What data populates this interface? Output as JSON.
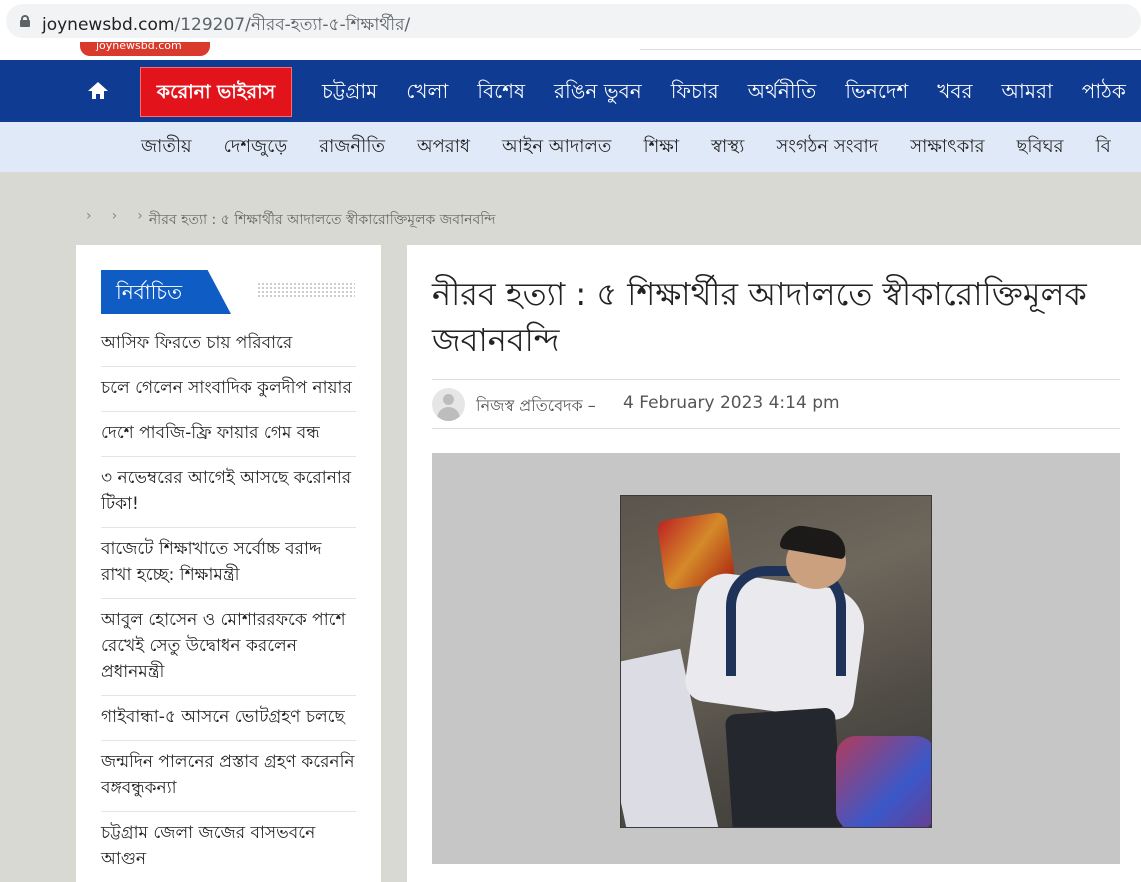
{
  "browser": {
    "url_host": "joynewsbd.com",
    "url_path": "/129207/নীরব-হত্যা-৫-শিক্ষার্থীর/"
  },
  "site": {
    "logo_text": "joynewsbd.com"
  },
  "main_nav": {
    "highlight": "করোনা ভাইরাস",
    "items": [
      "চট্টগ্রাম",
      "খেলা",
      "বিশেষ",
      "রঙিন ভুবন",
      "ফিচার",
      "অর্থনীতি",
      "ভিনদেশ",
      "খবর",
      "আমরা",
      "পাঠক"
    ]
  },
  "sub_nav": {
    "items": [
      "জাতীয়",
      "দেশজুড়ে",
      "রাজনীতি",
      "অপরাধ",
      "আইন আদালত",
      "শিক্ষা",
      "স্বাস্থ্য",
      "সংগঠন সংবাদ",
      "সাক্ষাৎকার",
      "ছবিঘর",
      "বি"
    ]
  },
  "breadcrumb": {
    "chevron": "›",
    "current": "নীরব হত্যা : ৫ শিক্ষার্থীর আদালতে স্বীকারোক্তিমূলক জবানবন্দি"
  },
  "sidebar": {
    "heading": "নির্বাচিত",
    "items": [
      "আসিফ ফিরতে চায় পরিবারে",
      "চলে গেলেন সাংবাদিক কুলদীপ নায়ার",
      "দেশে পাবজি-ফ্রি ফায়ার গেম বন্ধ",
      "৩ নভেম্বরের আগেই আসছে করোনার টিকা!",
      "বাজেটে শিক্ষাখাতে সর্বোচ্চ বরাদ্দ রাখা হচ্ছে: শিক্ষামন্ত্রী",
      "আবুল হোসেন ও মোশাররফকে পাশে রেখেই সেতু উদ্বোধন করলেন প্রধানমন্ত্রী",
      "গাইবান্ধা-৫ আসনে ভোটগ্রহণ চলছে",
      "জন্মদিন পালনের প্রস্তাব গ্রহণ করেননি বঙ্গবন্ধুকন্যা",
      "চট্টগ্রাম জেলা জজের বাসভবনে আগুন"
    ]
  },
  "article": {
    "title": "নীরব হত্যা : ৫ শিক্ষার্থীর আদালতে স্বীকারোক্তিমূলক জবানবন্দি",
    "author": "নিজস্ব প্রতিবেদক –",
    "date": "4 February 2023 4:14 pm"
  },
  "colors": {
    "main_nav_bg": "#0f3c92",
    "corona_red": "#e3131b",
    "sub_nav_bg": "#dfe9f7",
    "sidebar_tab_blue": "#0f5cc4"
  },
  "icons": [
    "lock-icon",
    "home-icon",
    "avatar-icon"
  ]
}
